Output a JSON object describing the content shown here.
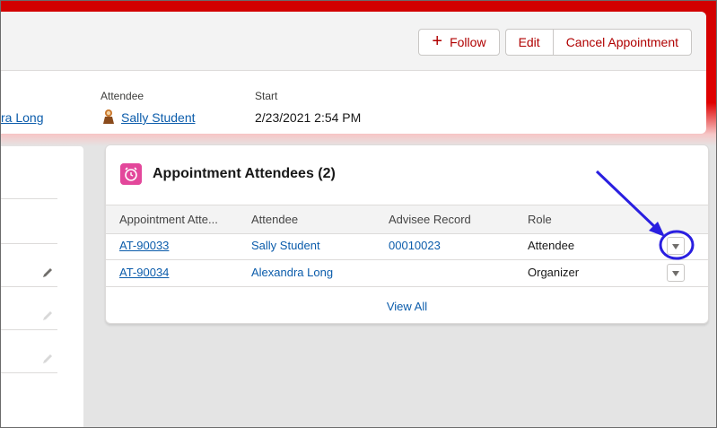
{
  "header": {
    "buttons": {
      "follow": "Follow",
      "edit": "Edit",
      "cancel": "Cancel Appointment"
    },
    "fields": {
      "organizer_partial": "ra Long",
      "attendee_label": "Attendee",
      "attendee_value": "Sally Student",
      "start_label": "Start",
      "start_value": "2/23/2021 2:54 PM"
    }
  },
  "attendees_card": {
    "title": "Appointment Attendees (2)",
    "columns": [
      "Appointment Atte...",
      "Attendee",
      "Advisee Record",
      "Role"
    ],
    "rows": [
      {
        "id": "AT-90033",
        "attendee": "Sally Student",
        "advisee_record": "00010023",
        "role": "Attendee"
      },
      {
        "id": "AT-90034",
        "attendee": "Alexandra Long",
        "advisee_record": "",
        "role": "Organizer"
      }
    ],
    "view_all": "View All"
  },
  "colors": {
    "brand_red": "#e00000",
    "link_blue": "#0b5cab",
    "annotation": "#2a1fe0",
    "icon_pink": "#e3479b"
  },
  "icons": [
    "plus-icon",
    "avatar-icon",
    "alarm-clock-icon",
    "pencil-icon",
    "chevron-down-icon"
  ]
}
